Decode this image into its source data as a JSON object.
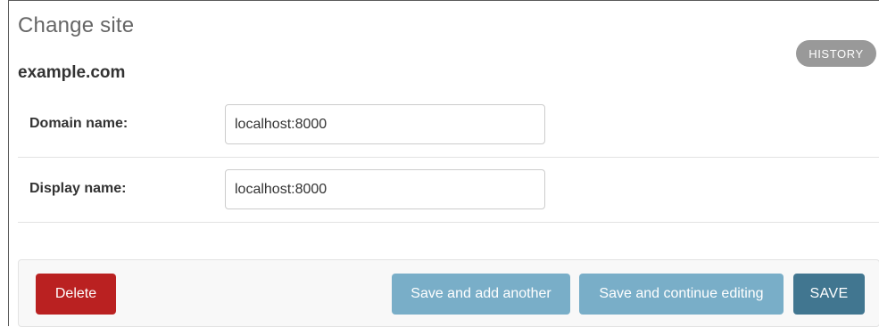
{
  "header": {
    "title": "Change site",
    "history_label": "HISTORY"
  },
  "object": {
    "name": "example.com"
  },
  "fields": [
    {
      "label": "Domain name:",
      "value": "localhost:8000"
    },
    {
      "label": "Display name:",
      "value": "localhost:8000"
    }
  ],
  "actions": {
    "delete_label": "Delete",
    "save_add_label": "Save and add another",
    "save_continue_label": "Save and continue editing",
    "save_label": "SAVE"
  },
  "colors": {
    "delete": "#ba2121",
    "secondary_button": "#79aec8",
    "primary_button": "#417690",
    "history_button": "#999999"
  }
}
